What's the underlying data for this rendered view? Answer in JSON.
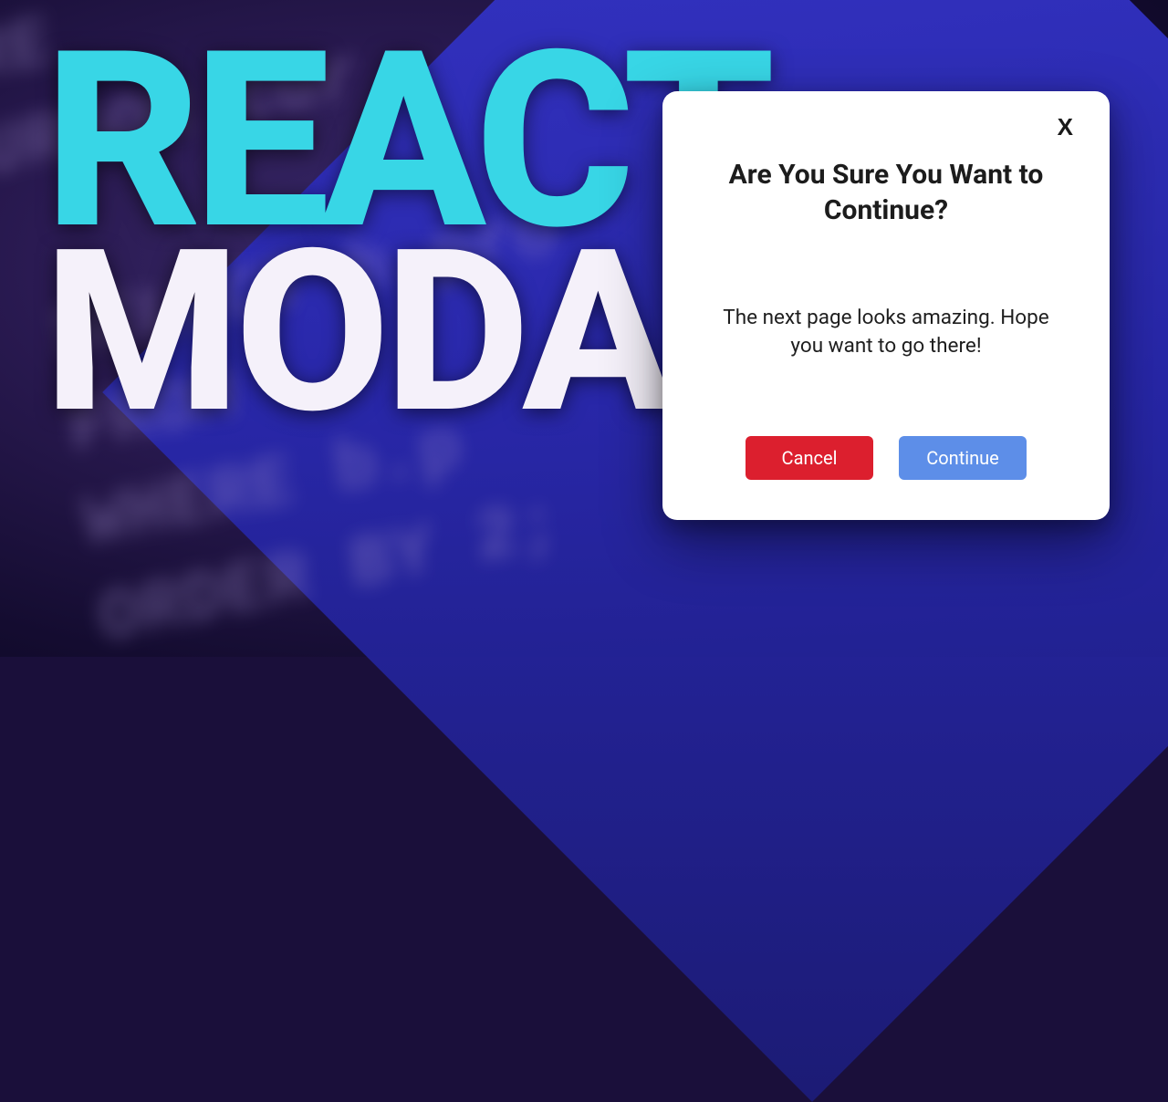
{
  "headline": {
    "line1": "REACT",
    "line2": "MODAL"
  },
  "background_code": {
    "lines": "ARE\nCURSOR cur\n\n  SELECT h.pro\n  FROM\n  WHERE b.p\n  ORDER BY 2;"
  },
  "modal": {
    "close_label": "X",
    "title": "Are You Sure You Want to Continue?",
    "body": "The next page looks amazing. Hope you want to go there!",
    "actions": {
      "cancel_label": "Cancel",
      "continue_label": "Continue"
    }
  },
  "colors": {
    "headline_cyan": "#38d6e6",
    "headline_offwhite": "#f5f1fa",
    "bg_dark_purple": "#1a0f3a",
    "triangle_blue": "#2828b0",
    "btn_cancel": "#dc1f2e",
    "btn_continue": "#5d8ee8"
  }
}
